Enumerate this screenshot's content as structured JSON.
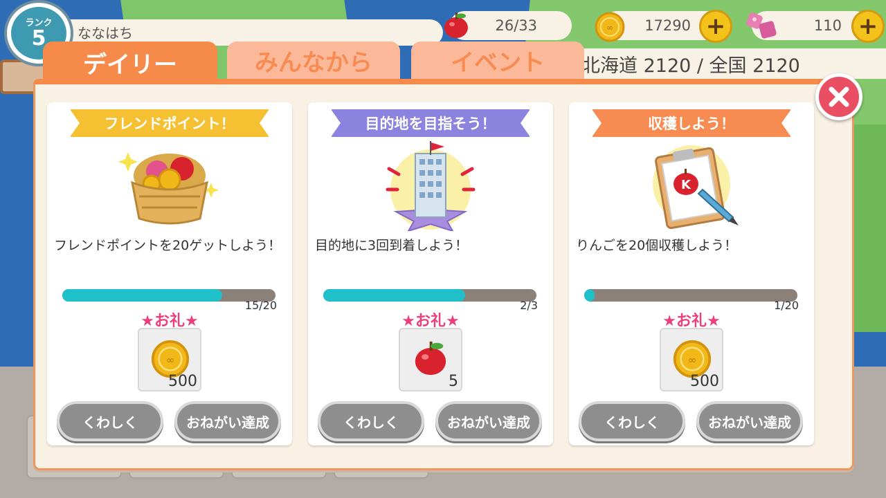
{
  "header": {
    "rank_label": "ランク",
    "rank": "5",
    "player_name": "ななはち",
    "apples": "26/33",
    "coins": "17290",
    "gems": "110",
    "plus_symbol": "+",
    "region_text": "北海道 2120 / 全国 2120"
  },
  "tabs": [
    {
      "label": "デイリー",
      "active": true
    },
    {
      "label": "みんなから",
      "active": false
    },
    {
      "label": "イベント",
      "active": false
    }
  ],
  "close_symbol": "✕",
  "reward_label": "★お礼★",
  "cards": [
    {
      "ribbon": "フレンドポイント！",
      "ribbon_color": "#f6c033",
      "illustration": "basket-icon",
      "description": "フレンドポイントを20ゲットしよう！",
      "progress_text": "15/20",
      "progress": 0.75,
      "reward_icon": "coin-icon",
      "reward_count": "500",
      "detail_button": "くわしく",
      "achieve_button": "おねがい達成"
    },
    {
      "ribbon": "目的地を目指そう！",
      "ribbon_color": "#8c83df",
      "illustration": "building-icon",
      "description": "目的地に3回到着しよう！",
      "progress_text": "2/3",
      "progress": 0.6667,
      "reward_icon": "apple-icon",
      "reward_count": "5",
      "detail_button": "くわしく",
      "achieve_button": "おねがい達成"
    },
    {
      "ribbon": "収穫しよう！",
      "ribbon_color": "#f68c52",
      "illustration": "clipboard-icon",
      "description": "りんごを20個収穫しよう！",
      "progress_text": "1/20",
      "progress": 0.05,
      "reward_icon": "coin-icon",
      "reward_count": "500",
      "detail_button": "くわしく",
      "achieve_button": "おねがい達成"
    }
  ]
}
